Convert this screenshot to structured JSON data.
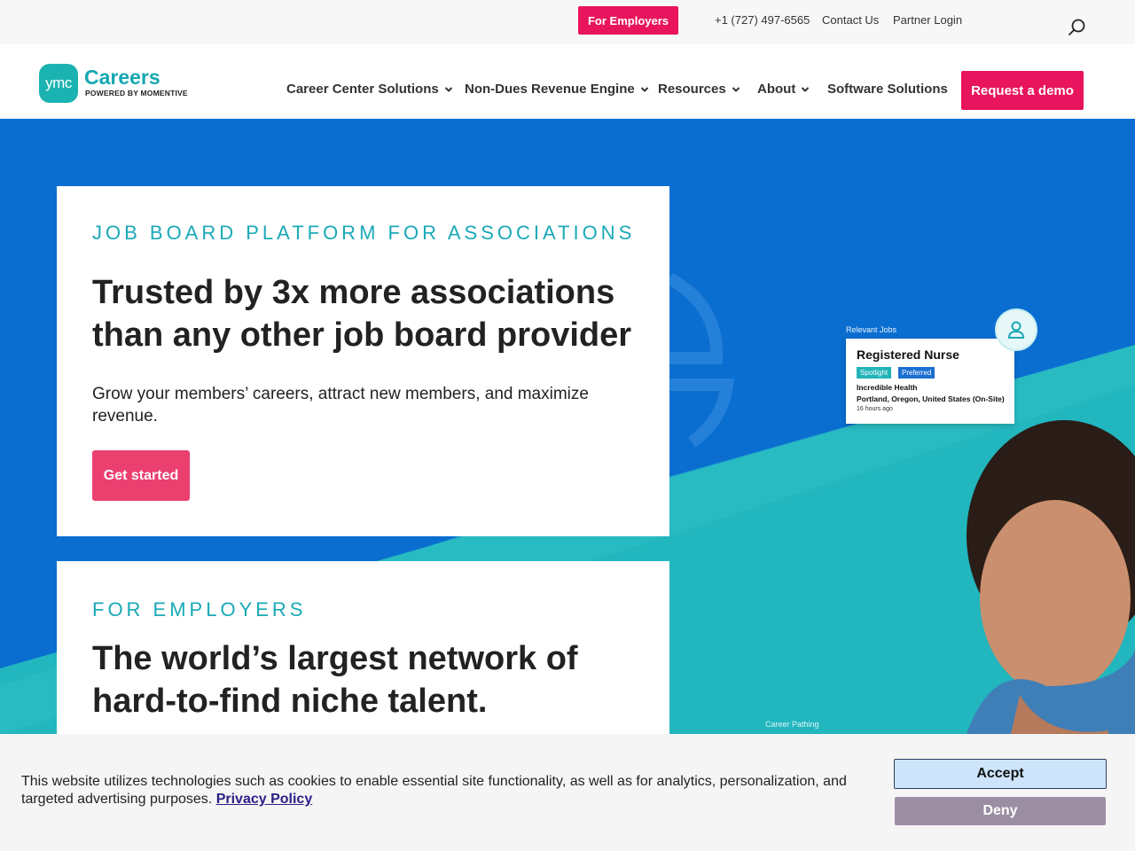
{
  "topbar": {
    "employers_button": "For Employers",
    "phone": "+1 (727) 497-6565",
    "contact": "Contact Us",
    "partner_login": "Partner Login",
    "search_icon": "search-icon"
  },
  "header": {
    "logo_badge": "ymc",
    "logo_word": "Careers",
    "logo_sub": "POWERED BY MOMENTIVE",
    "nav": [
      {
        "label": "Career Center Solutions",
        "has_dropdown": true
      },
      {
        "label": "Non-Dues Revenue Engine",
        "has_dropdown": true
      },
      {
        "label": "Resources",
        "has_dropdown": true
      },
      {
        "label": "About",
        "has_dropdown": true
      },
      {
        "label": "Software Solutions",
        "has_dropdown": false
      }
    ],
    "demo_button": "Request a demo"
  },
  "hero": {
    "card1": {
      "eyebrow": "JOB BOARD PLATFORM FOR ASSOCIATIONS",
      "headline": "Trusted by 3x more associations than any other job board provider",
      "subcopy": "Grow your members’ careers, attract new members, and maximize revenue.",
      "cta": "Get started"
    },
    "card2": {
      "eyebrow": "FOR EMPLOYERS",
      "headline": "The world’s largest network of hard-to-find niche talent."
    },
    "job_widget": {
      "heading": "Relevant Jobs",
      "title": "Registered Nurse",
      "tags": [
        "Spotlight",
        "Preferred"
      ],
      "company": "Incredible Health",
      "location": "Portland, Oregon, United States (On-Site)",
      "posted": "16 hours ago"
    },
    "career_pathing": "Career Pathing"
  },
  "cookie": {
    "text": "This website utilizes technologies such as cookies to enable essential site functionality, as well as for analytics, personalization, and targeted advertising purposes.",
    "link": "Privacy Policy",
    "accept": "Accept",
    "deny": "Deny"
  },
  "colors": {
    "brand_pink": "#e8145d",
    "brand_teal": "#19a9b7",
    "hero_blue": "#0a6ed1"
  }
}
